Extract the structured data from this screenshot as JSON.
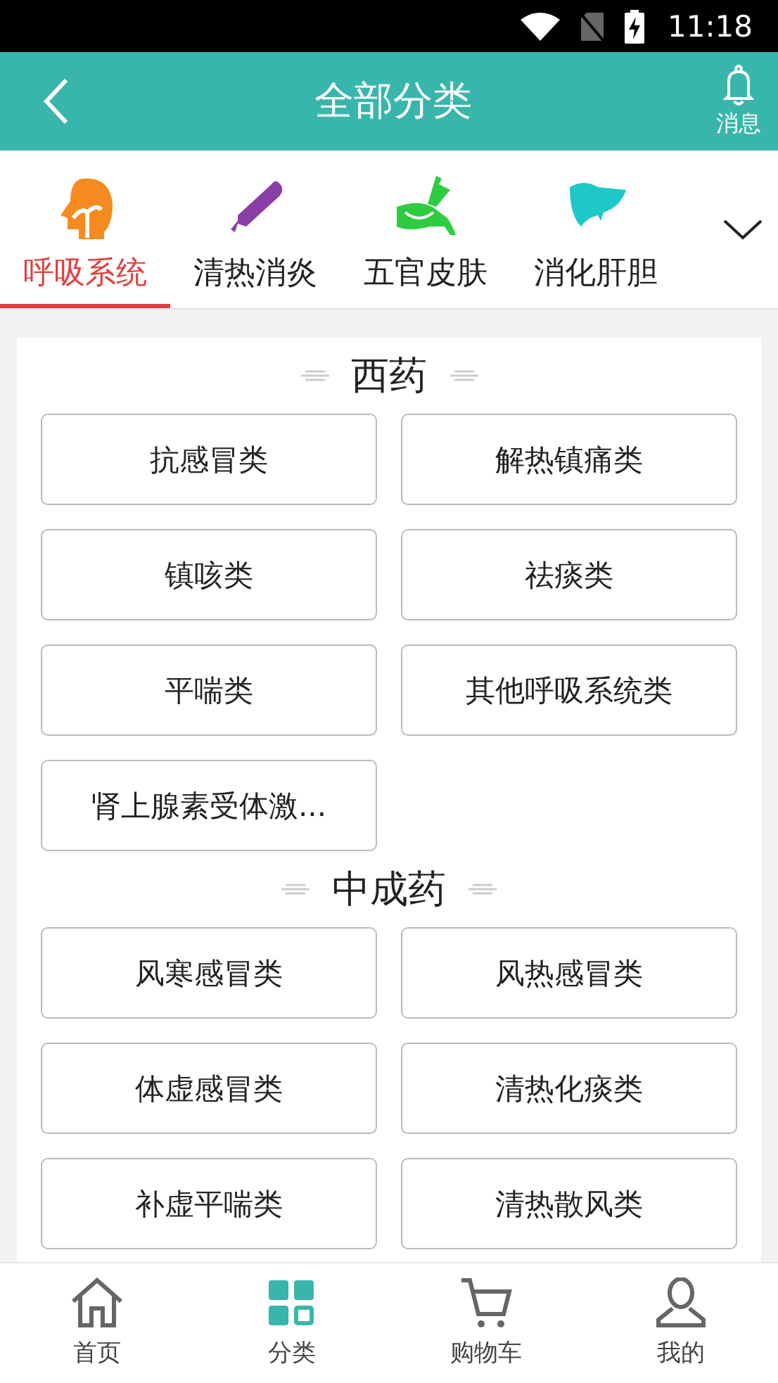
{
  "status_bar": {
    "time": "11:18"
  },
  "header": {
    "title": "全部分类",
    "message_label": "消息"
  },
  "category_tabs": [
    {
      "label": "呼吸系统",
      "selected": true,
      "kind": "head"
    },
    {
      "label": "清热消炎",
      "selected": false,
      "kind": "thermometer"
    },
    {
      "label": "五官皮肤",
      "selected": false,
      "kind": "ointment"
    },
    {
      "label": "消化肝胆",
      "selected": false,
      "kind": "liver"
    }
  ],
  "sections": [
    {
      "title": "西药",
      "items": [
        "抗感冒类",
        "解热镇痛类",
        "镇咳类",
        "祛痰类",
        "平喘类",
        "其他呼吸系统类",
        "肾上腺素受体激..."
      ]
    },
    {
      "title": "中成药",
      "items": [
        "风寒感冒类",
        "风热感冒类",
        "体虚感冒类",
        "清热化痰类",
        "补虚平喘类",
        "清热散风类"
      ]
    }
  ],
  "bottom_nav": [
    {
      "label": "首页",
      "selected": false,
      "kind": "home"
    },
    {
      "label": "分类",
      "selected": true,
      "kind": "grid"
    },
    {
      "label": "购物车",
      "selected": false,
      "kind": "cart"
    },
    {
      "label": "我的",
      "selected": false,
      "kind": "person"
    }
  ]
}
